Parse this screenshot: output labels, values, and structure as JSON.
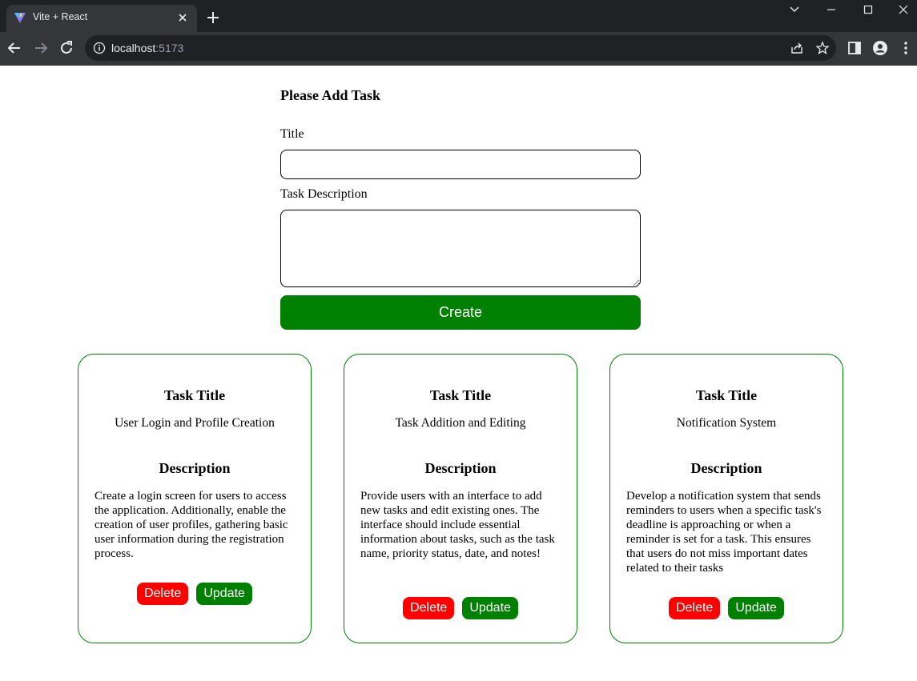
{
  "browser": {
    "tab_title": "Vite + React",
    "url_host": "localhost",
    "url_port": ":5173"
  },
  "form": {
    "heading": "Please Add Task",
    "title_label": "Title",
    "title_value": "",
    "description_label": "Task Description",
    "description_value": "",
    "create_label": "Create"
  },
  "tasks": [
    {
      "title_heading": "Task Title",
      "title": "User Login and Profile Creation",
      "description_heading": "Description",
      "description": "Create a login screen for users to access the application. Additionally, enable the creation of user profiles, gathering basic user information during the registration process.",
      "delete_label": "Delete",
      "update_label": "Update"
    },
    {
      "title_heading": "Task Title",
      "title": "Task Addition and Editing",
      "description_heading": "Description",
      "description": "Provide users with an interface to add new tasks and edit existing ones. The interface should include essential information about tasks, such as the task name, priority status, date, and notes!",
      "delete_label": "Delete",
      "update_label": "Update"
    },
    {
      "title_heading": "Task Title",
      "title": "Notification System",
      "description_heading": "Description",
      "description": "Develop a notification system that sends reminders to users when a specific task's deadline is approaching or when a reminder is set for a task. This ensures that users do not miss important dates related to their tasks",
      "delete_label": "Delete",
      "update_label": "Update"
    }
  ],
  "colors": {
    "accent_green": "#008000",
    "delete_red": "#ff0000",
    "chrome_dark": "#202124",
    "chrome_toolbar": "#35363a"
  }
}
